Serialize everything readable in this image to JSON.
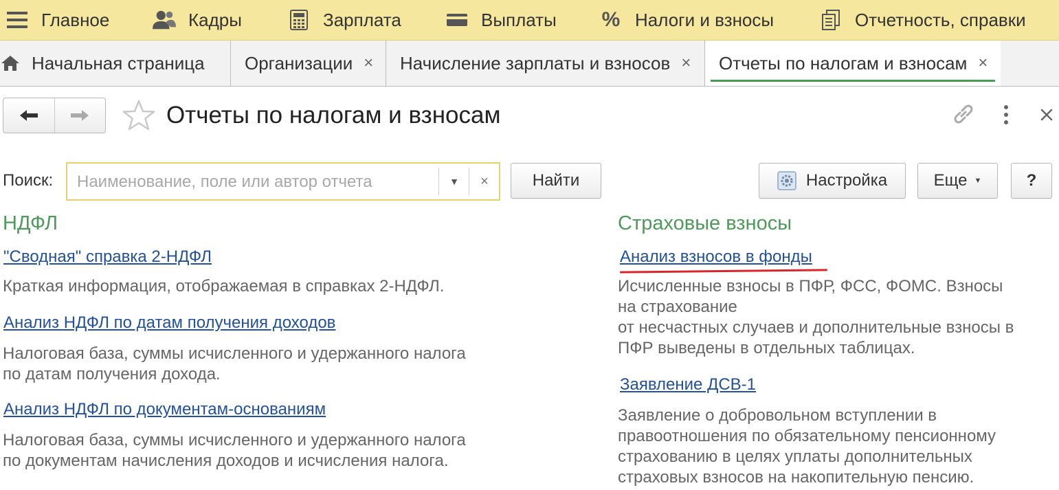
{
  "menu": {
    "items": [
      {
        "label": "Главное",
        "icon": "hamburger-icon"
      },
      {
        "label": "Кадры",
        "icon": "people-icon"
      },
      {
        "label": "Зарплата",
        "icon": "calculator-icon"
      },
      {
        "label": "Выплаты",
        "icon": "wallet-icon"
      },
      {
        "label": "Налоги и взносы",
        "icon": "percent-icon"
      },
      {
        "label": "Отчетность, справки",
        "icon": "documents-icon"
      }
    ]
  },
  "tabs": [
    {
      "label": "Начальная страница",
      "icon": "home-icon"
    },
    {
      "label": "Организации",
      "close": "×"
    },
    {
      "label": "Начисление зарплаты и взносов",
      "close": "×"
    },
    {
      "label": "Отчеты по налогам и взносам",
      "close": "×",
      "active": true
    }
  ],
  "header": {
    "title": "Отчеты по налогам и взносам"
  },
  "search": {
    "label": "Поиск:",
    "placeholder": "Наименование, поле или автор отчета",
    "value": "",
    "find_button": "Найти",
    "clear": "×"
  },
  "toolbar": {
    "settings_button": "Настройка",
    "more_button": "Еще",
    "help_button": "?"
  },
  "ndfl": {
    "title": "НДФЛ",
    "reports": [
      {
        "link": "\"Сводная\" справка 2-НДФЛ",
        "desc_lines": [
          "Краткая информация, отображаемая в справках 2-НДФЛ."
        ]
      },
      {
        "link": "Анализ НДФЛ по датам получения доходов",
        "desc_lines": [
          "Налоговая база, суммы исчисленного и удержанного налога",
          "по датам получения дохода."
        ]
      },
      {
        "link": "Анализ НДФЛ по документам-основаниям",
        "desc_lines": [
          "Налоговая база, суммы исчисленного и удержанного налога",
          "по документам начисления доходов и исчисления налога."
        ]
      }
    ]
  },
  "insurance": {
    "title": "Страховые взносы",
    "reports": [
      {
        "link": "Анализ взносов в фонды",
        "desc_lines": [
          "Исчисленные взносы в ПФР, ФСС, ФОМС. Взносы",
          "на страхование",
          "от несчастных случаев и дополнительные взносы в",
          "ПФР выведены в отдельных таблицах."
        ]
      },
      {
        "link": "Заявление ДСВ-1",
        "desc_lines": [
          "Заявление о добровольном вступлении в",
          "правоотношения по обязательному пенсионному",
          "страхованию в целях уплаты дополнительных",
          "страховых взносов на накопительную пенсию."
        ]
      }
    ]
  },
  "colors": {
    "menu_bg": "#f5e79e",
    "section_title": "#4f9a5a",
    "link": "#23519b",
    "active_tab_underline": "#4a9b52",
    "highlight_underline": "#d7272d",
    "search_border": "#e8d16a"
  }
}
